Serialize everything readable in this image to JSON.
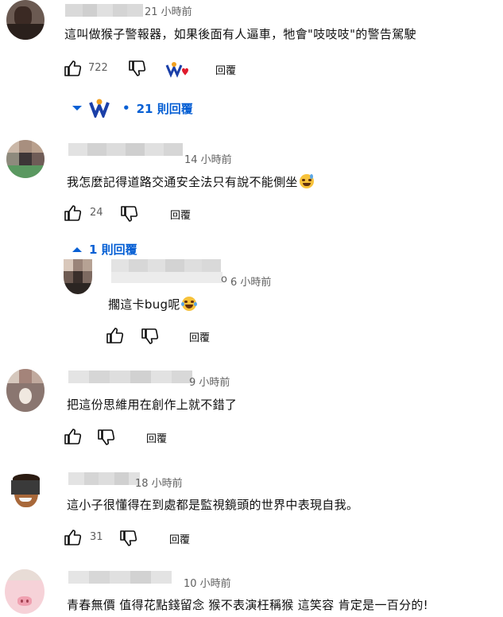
{
  "comments": [
    {
      "time": "21 小時前",
      "text": "這叫做猴子警報器，如果後面有人逼車，牠會\"吱吱吱\"的警告駕駛",
      "likes": "722",
      "reply_label": "回覆",
      "replies_toggle": "21 則回覆"
    },
    {
      "time": "14 小時前",
      "text": "我怎麼記得道路交通安全法只有說不能側坐",
      "likes": "24",
      "reply_label": "回覆",
      "replies_toggle": "1 則回覆"
    },
    {
      "time": "9 小時前",
      "text": "把這份思維用在創作上就不錯了",
      "likes": "",
      "reply_label": "回覆"
    },
    {
      "time": "18 小時前",
      "text": "這小子很懂得在到處都是監視鏡頭的世界中表現自我。",
      "likes": "31",
      "reply_label": "回覆"
    },
    {
      "time": "10 小時前",
      "text": "青春無價 值得花點錢留念 猴不表演枉稱猴 這笑容 肯定是一百分的!",
      "likes": "",
      "reply_label": "回覆"
    }
  ],
  "nested_reply": {
    "name_tail": "o",
    "time": "6 小時前",
    "text": "擱這卡bug呢",
    "reply_label": "回覆"
  },
  "icons": {
    "like": "thumbs-up-icon",
    "dislike": "thumbs-down-icon",
    "expand": "chevron-down-icon",
    "collapse": "chevron-up-icon",
    "creator_heart": "creator-heart-icon"
  },
  "colors": {
    "link_blue": "#065fd4",
    "meta_gray": "#606060",
    "text": "#0f0f0f"
  }
}
